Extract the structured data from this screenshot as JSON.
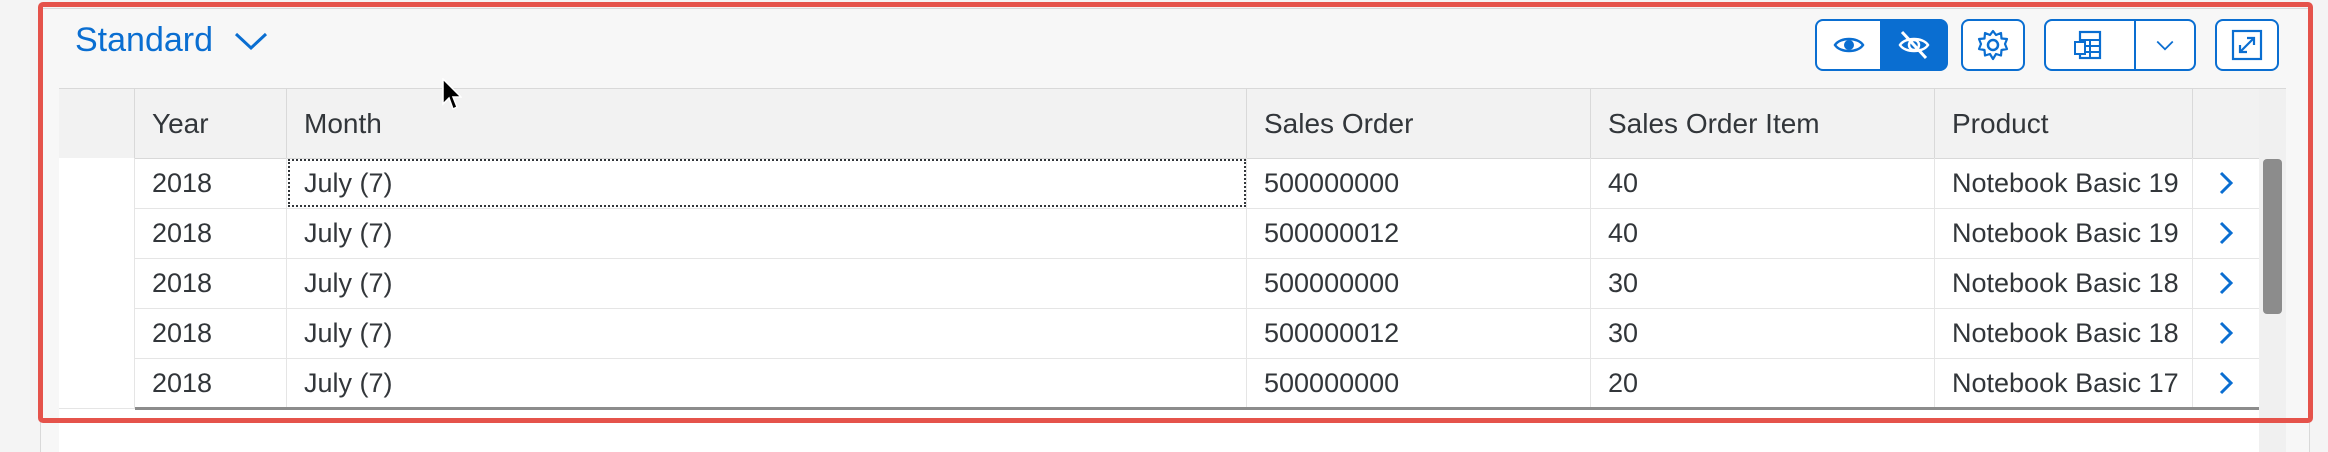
{
  "variant": {
    "title": "Standard"
  },
  "toolbar": {
    "show_details_label": "Show details",
    "hide_details_label": "Hide details",
    "settings_label": "Settings",
    "export_label": "Export",
    "export_menu_label": "Export options",
    "fullscreen_label": "Full screen",
    "hide_details_pressed": true
  },
  "table": {
    "columns": [
      "Year",
      "Month",
      "Sales Order",
      "Sales Order Item",
      "Product"
    ],
    "rows": [
      {
        "year": "2018",
        "month": "July (7)",
        "sales_order": "500000000",
        "item": "40",
        "product": "Notebook Basic 19"
      },
      {
        "year": "2018",
        "month": "July (7)",
        "sales_order": "500000012",
        "item": "40",
        "product": "Notebook Basic 19"
      },
      {
        "year": "2018",
        "month": "July (7)",
        "sales_order": "500000000",
        "item": "30",
        "product": "Notebook Basic 18"
      },
      {
        "year": "2018",
        "month": "July (7)",
        "sales_order": "500000012",
        "item": "30",
        "product": "Notebook Basic 18"
      },
      {
        "year": "2018",
        "month": "July (7)",
        "sales_order": "500000000",
        "item": "20",
        "product": "Notebook Basic 17"
      }
    ],
    "scroll_position": 0.0,
    "visible_fraction": 0.5
  },
  "colors": {
    "accent": "#0a6ed1",
    "highlight_frame": "#e5534b",
    "text": "#32363a"
  },
  "icons": [
    "chevron-down-icon",
    "eye-icon",
    "eye-slash-icon",
    "gear-icon",
    "spreadsheet-export-icon",
    "fullscreen-icon",
    "chevron-right-icon"
  ]
}
